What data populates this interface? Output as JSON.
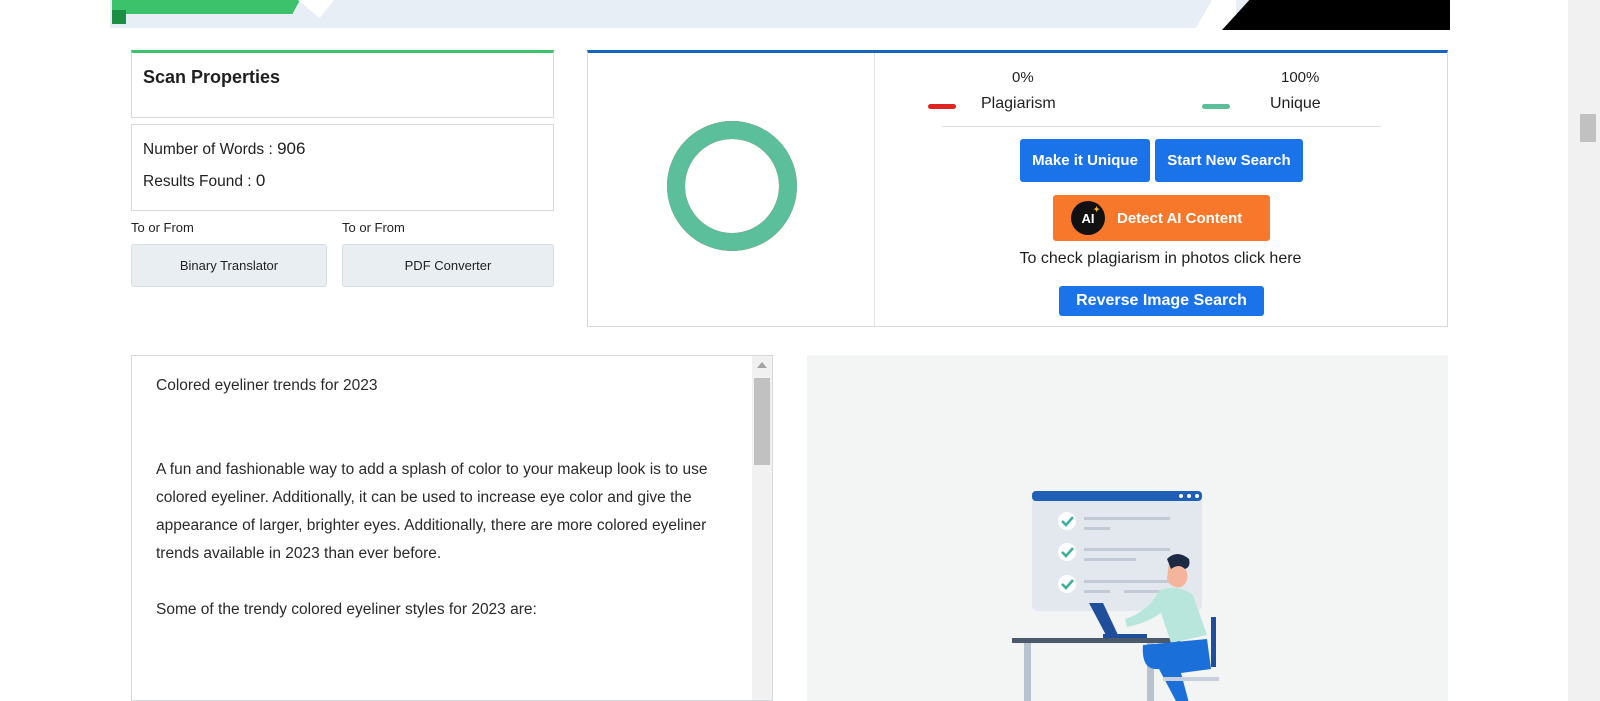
{
  "scan_properties": {
    "title": "Scan Properties",
    "words_label": "Number of Words : ",
    "words_value": "906",
    "results_label": "Results Found : ",
    "results_value": "0"
  },
  "tools": [
    {
      "label": "To or From",
      "button": "Binary Translator"
    },
    {
      "label": "To or From",
      "button": "PDF Converter"
    }
  ],
  "results": {
    "plagiarism_pct": "0%",
    "plagiarism_label": "Plagiarism",
    "unique_pct": "100%",
    "unique_label": "Unique",
    "plagiarism_value": 0,
    "unique_value": 100,
    "make_unique_button": "Make it Unique",
    "new_search_button": "Start New Search",
    "ai_badge": "AI",
    "detect_ai_button": "Detect AI Content",
    "photo_text": "To check plagiarism in photos click here",
    "reverse_image_button": "Reverse Image Search"
  },
  "editor": {
    "title_line": "Colored eyeliner trends for 2023",
    "paragraph1": "A fun and fashionable way to add a splash of color to your makeup look is to use colored eyeliner. Additionally, it can be used to increase eye color and give the appearance of larger, brighter eyes. Additionally, there are more colored eyeliner trends available in 2023 than ever before.",
    "paragraph2": "Some of the trendy colored eyeliner styles for 2023 are:"
  },
  "colors": {
    "scan_accent": "#3cc26b",
    "results_accent": "#1565c0",
    "plagiarism": "#e02424",
    "unique": "#5bbf9b",
    "primary_button": "#1a73e8",
    "ai_button": "#f7782b"
  },
  "icons": {
    "donut": "plagiarism-donut-chart",
    "ai": "ai-badge-icon",
    "illustration": "person-checklist-illustration"
  }
}
